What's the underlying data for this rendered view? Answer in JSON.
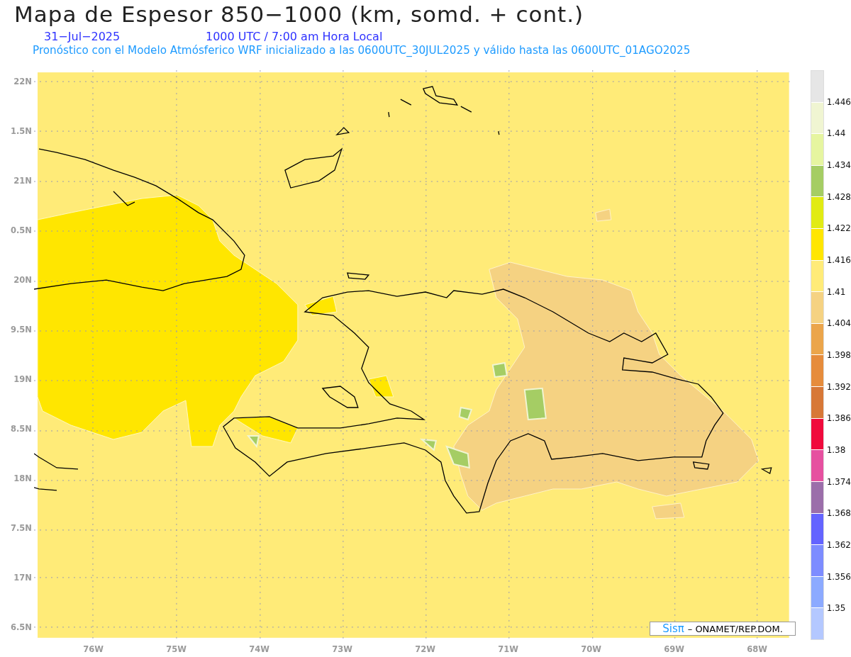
{
  "header": {
    "title": "Mapa de Espesor 850−1000 (km, somd. + cont.)",
    "date": "31−Jul−2025",
    "time": "1000 UTC / 7:00 am Hora Local",
    "subtitle": "Pronóstico con el Modelo Atmósferico WRF inicializado a las 0600UTC_30JUL2025 y válido hasta las  0600UTC_01AGO2025"
  },
  "map": {
    "lat_labels": [
      "22N",
      "1.5N",
      "21N",
      "0.5N",
      "20N",
      "9.5N",
      "19N",
      "8.5N",
      "18N",
      "7.5N",
      "17N",
      "6.5N"
    ],
    "lon_labels": [
      "76W",
      "75W",
      "74W",
      "73W",
      "72W",
      "71W",
      "70W",
      "69W",
      "68W"
    ],
    "credit": {
      "logo": "Sisπ",
      "text": "– ONAMET/REP.DOM."
    }
  },
  "colorbar": {
    "boxes": [
      {
        "color": "#e6e6e6"
      },
      {
        "color": "#f0f5d2"
      },
      {
        "color": "#e6f5a0"
      },
      {
        "color": "#a5cd64"
      },
      {
        "color": "#e1eb14"
      },
      {
        "color": "#ffe600"
      },
      {
        "color": "#ffeb78"
      },
      {
        "color": "#f5d282"
      },
      {
        "color": "#eba54b"
      },
      {
        "color": "#e68c3c"
      },
      {
        "color": "#d77837"
      },
      {
        "color": "#f00a3c"
      },
      {
        "color": "#e650a0"
      },
      {
        "color": "#9b6eaa"
      },
      {
        "color": "#6464ff"
      },
      {
        "color": "#7d8cff"
      },
      {
        "color": "#8caaff"
      },
      {
        "color": "#b4c8ff"
      }
    ],
    "labels": [
      "1.446",
      "1.44",
      "1.434",
      "1.428",
      "1.422",
      "1.416",
      "1.41",
      "1.404",
      "1.398",
      "1.392",
      "1.386",
      "1.38",
      "1.374",
      "1.368",
      "1.362",
      "1.356",
      "1.35"
    ]
  }
}
